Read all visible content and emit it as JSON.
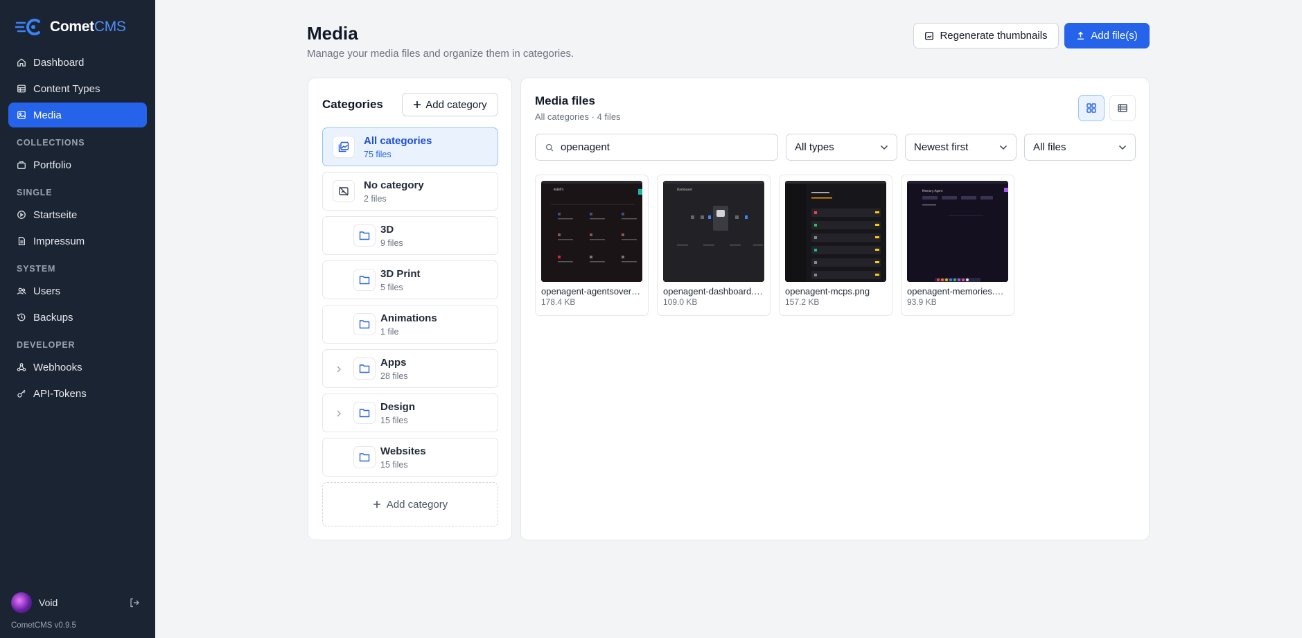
{
  "app": {
    "name_main": "Comet",
    "name_accent": "CMS",
    "version": "CometCMS v0.9.5"
  },
  "sidebar": {
    "items_top": [
      {
        "label": "Dashboard",
        "icon": "home-icon"
      },
      {
        "label": "Content Types",
        "icon": "table-icon"
      },
      {
        "label": "Media",
        "icon": "image-icon",
        "active": true
      }
    ],
    "collections_label": "COLLECTIONS",
    "collections": [
      {
        "label": "Portfolio",
        "icon": "briefcase-icon"
      }
    ],
    "single_label": "SINGLE",
    "single": [
      {
        "label": "Startseite",
        "icon": "circle-play-icon"
      },
      {
        "label": "Impressum",
        "icon": "file-icon"
      }
    ],
    "system_label": "SYSTEM",
    "system": [
      {
        "label": "Users",
        "icon": "users-icon"
      },
      {
        "label": "Backups",
        "icon": "history-icon"
      }
    ],
    "developer_label": "DEVELOPER",
    "developer": [
      {
        "label": "Webhooks",
        "icon": "webhook-icon"
      },
      {
        "label": "API-Tokens",
        "icon": "key-icon"
      }
    ],
    "user": {
      "name": "Void"
    }
  },
  "header": {
    "title": "Media",
    "subtitle": "Manage your media files and organize them in categories.",
    "regenerate_label": "Regenerate thumbnails",
    "add_files_label": "Add file(s)"
  },
  "categories": {
    "title": "Categories",
    "add_label": "Add category",
    "items": [
      {
        "name": "All categories",
        "count": "75 files"
      },
      {
        "name": "No category",
        "count": "2 files"
      },
      {
        "name": "3D",
        "count": "9 files"
      },
      {
        "name": "3D Print",
        "count": "5 files"
      },
      {
        "name": "Animations",
        "count": "1 file"
      },
      {
        "name": "Apps",
        "count": "28 files"
      },
      {
        "name": "Design",
        "count": "15 files"
      },
      {
        "name": "Websites",
        "count": "15 files"
      }
    ],
    "add_bottom_label": "Add category"
  },
  "media": {
    "title": "Media files",
    "subtitle": "All categories · 4 files",
    "search_value": "openagent",
    "type_filter": "All types",
    "sort": "Newest first",
    "file_filter": "All files",
    "files": [
      {
        "name": "openagent-agentsoverview.png",
        "size": "178.4 KB"
      },
      {
        "name": "openagent-dashboard.png",
        "size": "109.0 KB"
      },
      {
        "name": "openagent-mcps.png",
        "size": "157.2 KB"
      },
      {
        "name": "openagent-memories.png",
        "size": "93.9 KB"
      }
    ]
  },
  "colors": {
    "sidebar_bg": "#1b2433",
    "accent": "#2563eb",
    "page_bg": "#f3f4f6"
  }
}
